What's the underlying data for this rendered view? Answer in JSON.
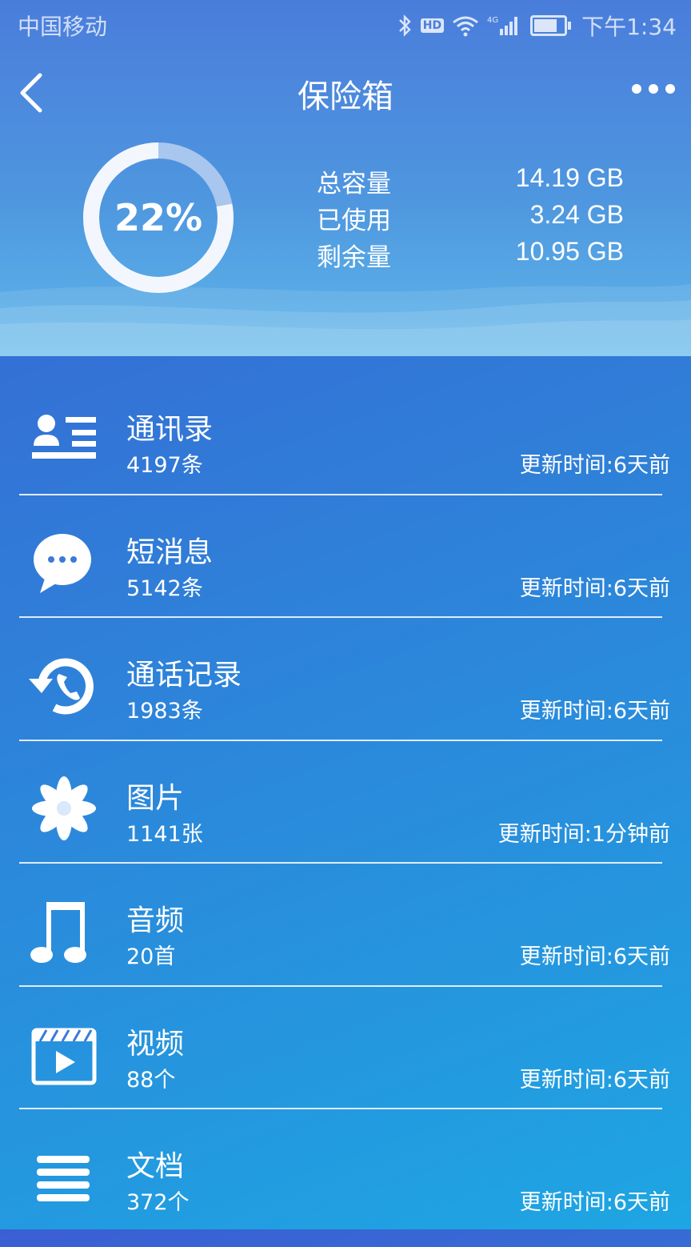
{
  "status_bar": {
    "carrier": "中国移动",
    "network": "4G",
    "hd": "HD",
    "time": "下午1:34",
    "icons": [
      "bluetooth-icon",
      "hd-icon",
      "wifi-icon",
      "signal-icon",
      "battery-icon"
    ]
  },
  "header": {
    "title": "保险箱",
    "back_icon": "chevron-left-icon",
    "more_icon": "more-dots-icon"
  },
  "storage": {
    "percent_label": "22%",
    "used_fraction": 0.22,
    "rows": [
      {
        "label": "总容量",
        "value": "14.19 GB"
      },
      {
        "label": "已使用",
        "value": "3.24 GB"
      },
      {
        "label": "剩余量",
        "value": "10.95 GB"
      }
    ]
  },
  "items": [
    {
      "title": "通讯录",
      "count": "4197条",
      "updated": "更新时间:6天前",
      "icon": "contacts-icon"
    },
    {
      "title": "短消息",
      "count": "5142条",
      "updated": "更新时间:6天前",
      "icon": "message-icon"
    },
    {
      "title": "通话记录",
      "count": "1983条",
      "updated": "更新时间:6天前",
      "icon": "call-history-icon"
    },
    {
      "title": "图片",
      "count": "1141张",
      "updated": "更新时间:1分钟前",
      "icon": "flower-icon"
    },
    {
      "title": "音频",
      "count": "20首",
      "updated": "更新时间:6天前",
      "icon": "music-note-icon"
    },
    {
      "title": "视频",
      "count": "88个",
      "updated": "更新时间:6天前",
      "icon": "video-icon"
    },
    {
      "title": "文档",
      "count": "372个",
      "updated": "更新时间:6天前",
      "icon": "document-icon"
    }
  ],
  "colors": {
    "ring_track": "#a9c6ee",
    "ring_fill": "#f3f7fd",
    "accent": "#ffffff"
  }
}
